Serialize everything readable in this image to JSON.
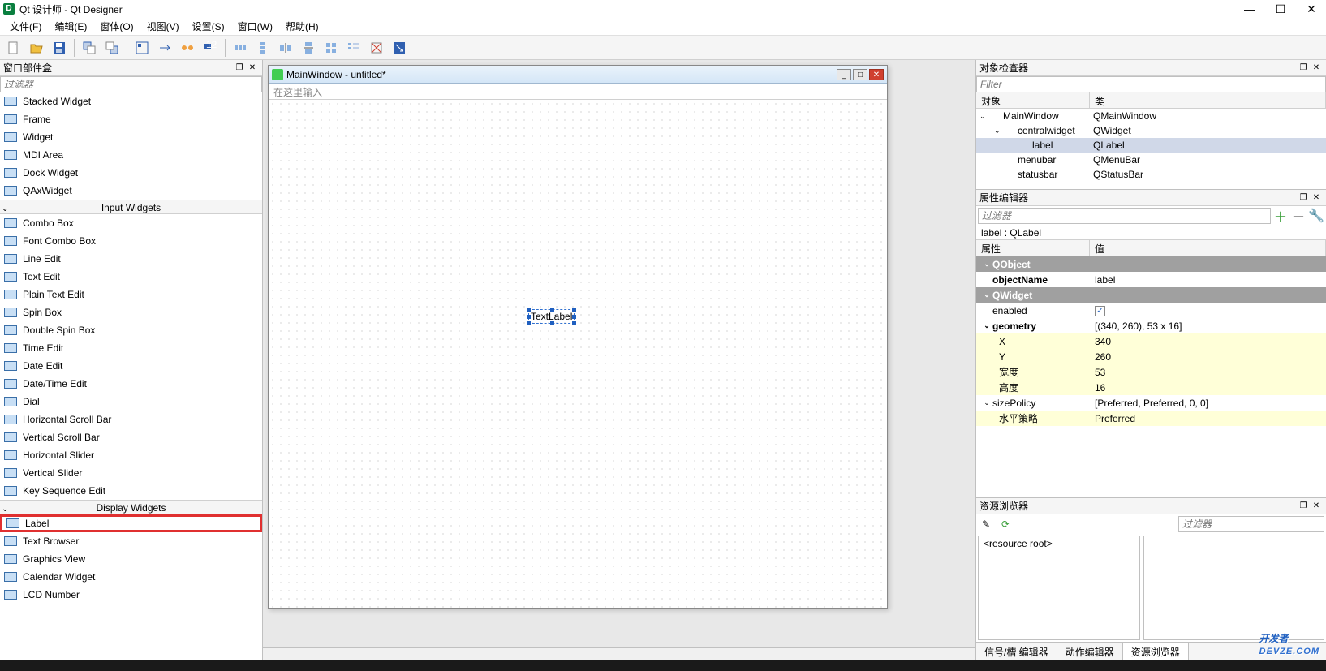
{
  "titlebar": {
    "title": "Qt 设计师 - Qt Designer"
  },
  "menubar": {
    "items": [
      "文件(F)",
      "编辑(E)",
      "窗体(O)",
      "视图(V)",
      "设置(S)",
      "窗口(W)",
      "帮助(H)"
    ]
  },
  "widget_box": {
    "title": "窗口部件盒",
    "filter_placeholder": "过滤器",
    "containers": [
      "Stacked Widget",
      "Frame",
      "Widget",
      "MDI Area",
      "Dock Widget",
      "QAxWidget"
    ],
    "category_input": "Input Widgets",
    "input_widgets": [
      "Combo Box",
      "Font Combo Box",
      "Line Edit",
      "Text Edit",
      "Plain Text Edit",
      "Spin Box",
      "Double Spin Box",
      "Time Edit",
      "Date Edit",
      "Date/Time Edit",
      "Dial",
      "Horizontal Scroll Bar",
      "Vertical Scroll Bar",
      "Horizontal Slider",
      "Vertical Slider",
      "Key Sequence Edit"
    ],
    "category_display": "Display Widgets",
    "display_widgets": [
      "Label",
      "Text Browser",
      "Graphics View",
      "Calendar Widget",
      "LCD Number"
    ]
  },
  "form": {
    "window_title": "MainWindow - untitled*",
    "menubar_hint": "在这里输入",
    "label_text": "TextLabel"
  },
  "object_inspector": {
    "title": "对象检查器",
    "filter_placeholder": "Filter",
    "col_object": "对象",
    "col_class": "类",
    "rows": [
      {
        "indent": 0,
        "exp": "⌄",
        "name": "MainWindow",
        "class": "QMainWindow"
      },
      {
        "indent": 1,
        "exp": "⌄",
        "name": "centralwidget",
        "class": "QWidget"
      },
      {
        "indent": 2,
        "exp": "",
        "name": "label",
        "class": "QLabel",
        "sel": true
      },
      {
        "indent": 1,
        "exp": "",
        "name": "menubar",
        "class": "QMenuBar"
      },
      {
        "indent": 1,
        "exp": "",
        "name": "statusbar",
        "class": "QStatusBar"
      }
    ]
  },
  "property_editor": {
    "title": "属性编辑器",
    "filter_placeholder": "过滤器",
    "selection": "label : QLabel",
    "col_prop": "属性",
    "col_value": "值",
    "rows": [
      {
        "type": "group",
        "name": "QObject"
      },
      {
        "type": "prop",
        "name": "objectName",
        "value": "label",
        "bold": true
      },
      {
        "type": "group",
        "name": "QWidget"
      },
      {
        "type": "prop",
        "name": "enabled",
        "value": "checkbox"
      },
      {
        "type": "expand",
        "name": "geometry",
        "value": "[(340, 260), 53 x 16]",
        "bold": true
      },
      {
        "type": "child",
        "name": "X",
        "value": "340"
      },
      {
        "type": "child",
        "name": "Y",
        "value": "260"
      },
      {
        "type": "child",
        "name": "宽度",
        "value": "53"
      },
      {
        "type": "child",
        "name": "高度",
        "value": "16"
      },
      {
        "type": "expand",
        "name": "sizePolicy",
        "value": "[Preferred, Preferred, 0, 0]"
      },
      {
        "type": "child",
        "name": "水平策略",
        "value": "Preferred"
      }
    ]
  },
  "resource_browser": {
    "title": "资源浏览器",
    "filter_placeholder": "过滤器",
    "root": "<resource root>"
  },
  "bottom_tabs": {
    "tabs": [
      "信号/槽 编辑器",
      "动作编辑器",
      "资源浏览器"
    ],
    "active": 2
  },
  "watermark": {
    "main": "开发者",
    "sub": "DEVZE.COM"
  }
}
